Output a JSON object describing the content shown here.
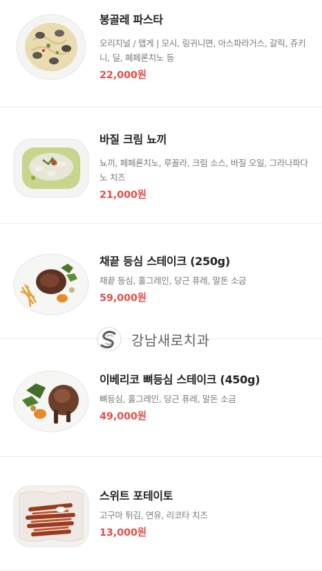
{
  "menu": {
    "items": [
      {
        "name": "봉골레 파스타",
        "description": "오리지널 / 맵게 | 모시, 링귀니면, 아스파라거스, 갈릭, 쥬키니, 딜, 페페론치노 등",
        "price": "22,000원",
        "image_icon": "pasta-dish-icon"
      },
      {
        "name": "바질 크림 뇨끼",
        "description": "뇨끼, 페페론치노, 루꼴라, 크림 소스, 바질 오일, 그라나파다노 치즈",
        "price": "21,000원",
        "image_icon": "gnocchi-dish-icon"
      },
      {
        "name": "채끝 등심 스테이크 (250g)",
        "description": "채끝 등심, 홀그레인, 당근 퓨레, 말돈 소금",
        "price": "59,000원",
        "image_icon": "steak-dish-icon"
      },
      {
        "name": "이베리코 뼈등심 스테이크 (450g)",
        "description": "뼈등심, 홀그레인, 당근 퓨레, 말돈 소금",
        "price": "49,000원",
        "image_icon": "pork-steak-dish-icon"
      },
      {
        "name": "스위트 포테이토",
        "description": "고구마 튀김, 연유, 리코타 치즈",
        "price": "13,000원",
        "image_icon": "sweet-potato-fries-icon"
      }
    ]
  },
  "watermark": {
    "text": "강남새로치과",
    "icon": "s-logo-icon"
  },
  "colors": {
    "price": "#e0504a",
    "name": "#222222",
    "description": "#7a7a7a",
    "divider": "#ececec"
  }
}
